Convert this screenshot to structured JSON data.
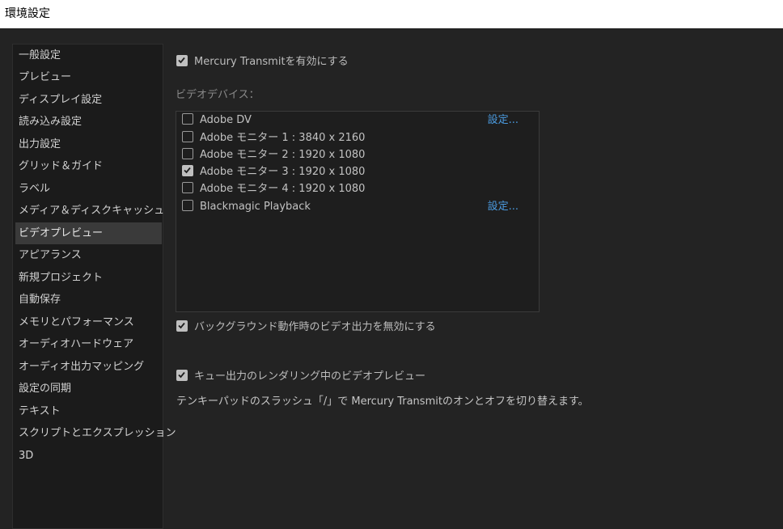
{
  "window": {
    "title": "環境設定"
  },
  "sidebar": {
    "items": [
      {
        "label": "一般設定",
        "selected": false
      },
      {
        "label": "プレビュー",
        "selected": false
      },
      {
        "label": "ディスプレイ設定",
        "selected": false
      },
      {
        "label": "読み込み設定",
        "selected": false
      },
      {
        "label": "出力設定",
        "selected": false
      },
      {
        "label": "グリッド＆ガイド",
        "selected": false
      },
      {
        "label": "ラベル",
        "selected": false
      },
      {
        "label": "メディア＆ディスクキャッシュ",
        "selected": false
      },
      {
        "label": "ビデオプレビュー",
        "selected": true
      },
      {
        "label": "アピアランス",
        "selected": false
      },
      {
        "label": "新規プロジェクト",
        "selected": false
      },
      {
        "label": "自動保存",
        "selected": false
      },
      {
        "label": "メモリとパフォーマンス",
        "selected": false
      },
      {
        "label": "オーディオハードウェア",
        "selected": false
      },
      {
        "label": "オーディオ出力マッピング",
        "selected": false
      },
      {
        "label": "設定の同期",
        "selected": false
      },
      {
        "label": "テキスト",
        "selected": false
      },
      {
        "label": "スクリプトとエクスプレッション",
        "selected": false
      },
      {
        "label": "3D",
        "selected": false
      }
    ]
  },
  "main": {
    "enable_mercury": {
      "label": "Mercury Transmitを有効にする",
      "checked": true
    },
    "video_devices_label": "ビデオデバイス：",
    "devices": [
      {
        "label": "Adobe DV",
        "checked": false,
        "settings": "設定..."
      },
      {
        "label": "Adobe モニター 1 : 3840 x 2160",
        "checked": false,
        "settings": ""
      },
      {
        "label": "Adobe モニター 2 : 1920 x 1080",
        "checked": false,
        "settings": ""
      },
      {
        "label": "Adobe モニター 3 : 1920 x 1080",
        "checked": true,
        "settings": ""
      },
      {
        "label": "Adobe モニター 4 : 1920 x 1080",
        "checked": false,
        "settings": ""
      },
      {
        "label": "Blackmagic Playback",
        "checked": false,
        "settings": "設定..."
      }
    ],
    "disable_background": {
      "label": "バックグラウンド動作時のビデオ出力を無効にする",
      "checked": true
    },
    "render_queue_preview": {
      "label": "キュー出力のレンダリング中のビデオプレビュー",
      "checked": true
    },
    "note": "テンキーパッドのスラッシュ「/」で Mercury Transmitのオンとオフを切り替えます。"
  },
  "colors": {
    "link": "#4b9be0",
    "selected_bg": "#3a3a3a",
    "panel_bg": "#232323"
  },
  "icons": {
    "checkmark": "checkmark-icon"
  }
}
